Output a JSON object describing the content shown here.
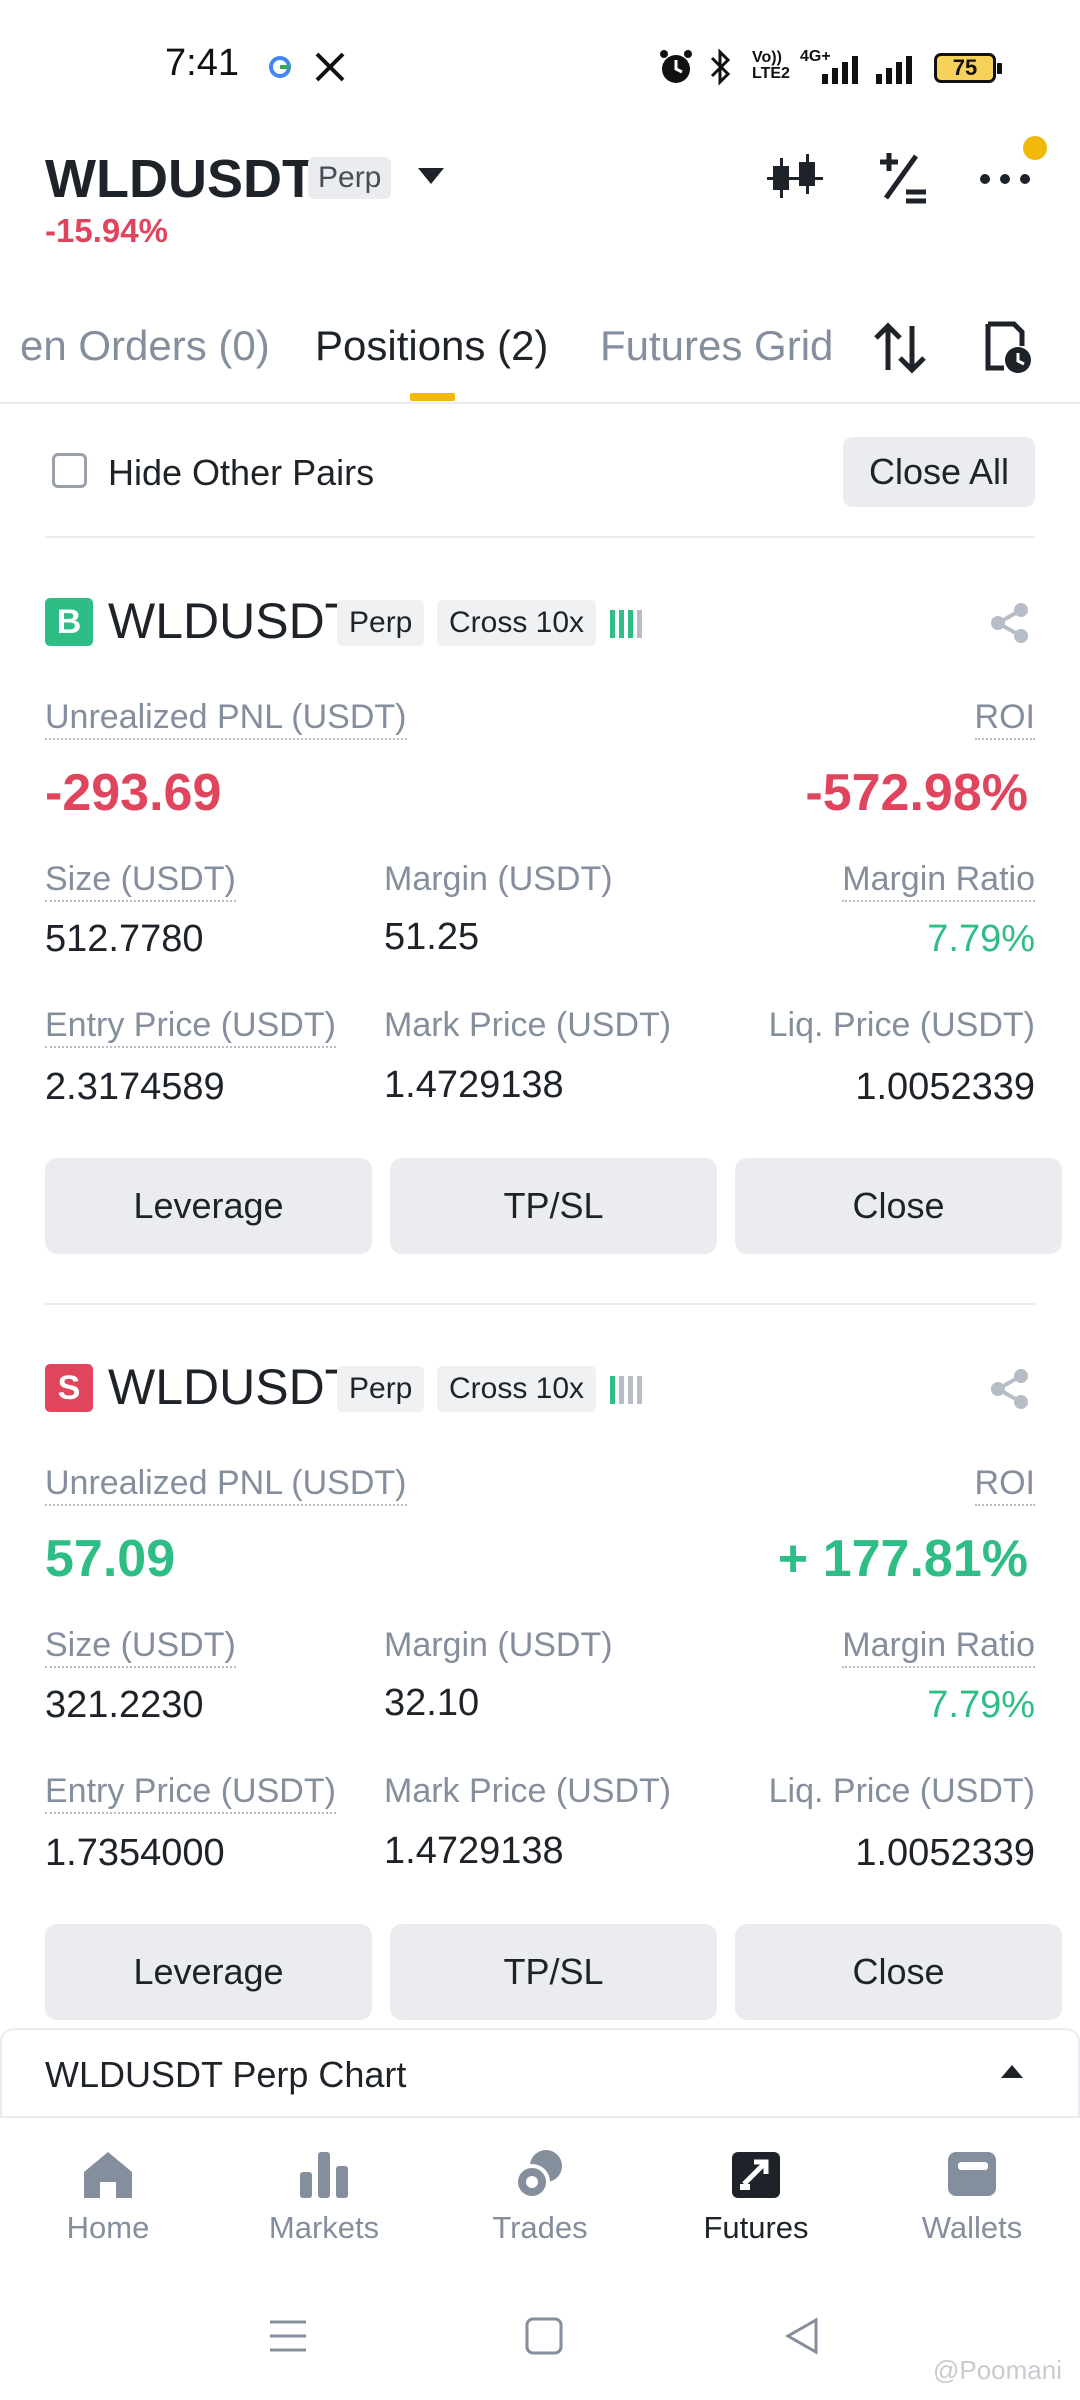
{
  "status_bar": {
    "time": "7:41",
    "battery": "75",
    "network": "4G+",
    "volte": "VoLTE"
  },
  "header": {
    "symbol": "WLDUSDT",
    "badge": "Perp",
    "change": "-15.94%",
    "icons": [
      "candlestick-icon",
      "percent-icon",
      "more-icon"
    ]
  },
  "tabs": [
    {
      "label": "en Orders (0)",
      "active": false
    },
    {
      "label": "Positions (2)",
      "active": true
    },
    {
      "label": "Futures Grid",
      "active": false
    }
  ],
  "filter": {
    "hide_label": "Hide Other Pairs",
    "close_all": "Close All"
  },
  "positions": [
    {
      "side": "B",
      "symbol": "WLDUSDT",
      "type": "Perp",
      "mode": "Cross 10x",
      "pnl_label": "Unrealized PNL (USDT)",
      "pnl": "-293.69",
      "roi_label": "ROI",
      "roi": "-572.98%",
      "size_label": "Size (USDT)",
      "size": "512.7780",
      "margin_label": "Margin (USDT)",
      "margin": "51.25",
      "margin_ratio_label": "Margin Ratio",
      "margin_ratio": "7.79%",
      "entry_label": "Entry Price (USDT)",
      "entry": "2.3174589",
      "mark_label": "Mark Price (USDT)",
      "mark": "1.4729138",
      "liq_label": "Liq. Price (USDT)",
      "liq": "1.0052339",
      "buttons": [
        "Leverage",
        "TP/SL",
        "Close"
      ]
    },
    {
      "side": "S",
      "symbol": "WLDUSDT",
      "type": "Perp",
      "mode": "Cross 10x",
      "pnl_label": "Unrealized PNL (USDT)",
      "pnl": "57.09",
      "roi_label": "ROI",
      "roi": "+ 177.81%",
      "size_label": "Size (USDT)",
      "size": "321.2230",
      "margin_label": "Margin (USDT)",
      "margin": "32.10",
      "margin_ratio_label": "Margin Ratio",
      "margin_ratio": "7.79%",
      "entry_label": "Entry Price (USDT)",
      "entry": "1.7354000",
      "mark_label": "Mark Price (USDT)",
      "mark": "1.4729138",
      "liq_label": "Liq. Price (USDT)",
      "liq": "1.0052339",
      "buttons": [
        "Leverage",
        "TP/SL",
        "Close"
      ]
    }
  ],
  "chart_bar": {
    "label": "WLDUSDT Perp Chart"
  },
  "bottom_nav": [
    {
      "label": "Home",
      "icon": "home-icon",
      "active": false
    },
    {
      "label": "Markets",
      "icon": "markets-icon",
      "active": false
    },
    {
      "label": "Trades",
      "icon": "trades-icon",
      "active": false
    },
    {
      "label": "Futures",
      "icon": "futures-icon",
      "active": true
    },
    {
      "label": "Wallets",
      "icon": "wallets-icon",
      "active": false
    }
  ],
  "watermark": "@Poomani",
  "colors": {
    "accent": "#f0b90b",
    "loss": "#e0455e",
    "profit": "#2ebd85",
    "muted": "#848e9c"
  }
}
